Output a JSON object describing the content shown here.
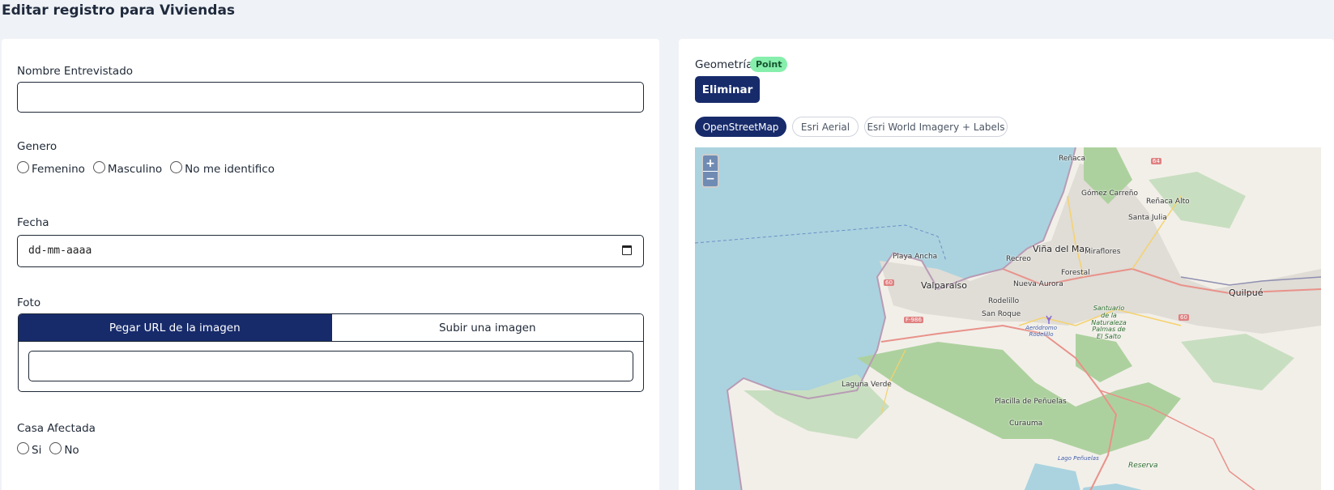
{
  "page": {
    "title": "Editar registro para Viviendas"
  },
  "form": {
    "nombre": {
      "label": "Nombre Entrevistado",
      "value": ""
    },
    "genero": {
      "label": "Genero",
      "options": [
        "Femenino",
        "Masculino",
        "No me identifico"
      ]
    },
    "fecha": {
      "label": "Fecha",
      "placeholder": "dd-mm-aaaa"
    },
    "foto": {
      "label": "Foto",
      "tabs": [
        "Pegar URL de la imagen",
        "Subir una imagen"
      ],
      "active_tab": "Pegar URL de la imagen",
      "url_value": ""
    },
    "casa": {
      "label": "Casa Afectada",
      "options": [
        "Si",
        "No"
      ]
    }
  },
  "geometry": {
    "label": "Geometría",
    "type_badge": "Point",
    "delete_label": "Eliminar",
    "layers": [
      "OpenStreetMap",
      "Esri Aerial",
      "Esri World Imagery + Labels"
    ],
    "active_layer": "OpenStreetMap"
  },
  "map": {
    "zoom_in": "+",
    "zoom_out": "−",
    "labels": {
      "renaca": "Reñaca",
      "gomez_carreno": "Gómez Carreño",
      "renaca_alto": "Reñaca Alto",
      "santa_julia": "Santa Julia",
      "playa_ancha": "Playa Ancha",
      "vina_del_mar": "Viña del Mar",
      "recreo": "Recreo",
      "miraflores": "Miraflores",
      "forestal": "Forestal",
      "valparaiso": "Valparaíso",
      "nueva_aurora": "Nueva Aurora",
      "rodelillo": "Rodelillo",
      "san_roque": "San Roque",
      "quilpue": "Quilpué",
      "laguna_verde": "Laguna Verde",
      "placilla": "Placilla de Peñuelas",
      "curauma": "Curauma",
      "reserva": "Reserva",
      "santuario": "Santuario de la Naturaleza Palmas de El Salto",
      "aerodromo": "Aeródromo Rodelillo",
      "lago": "Lago Peñuelas",
      "r64": "64",
      "r60a": "60",
      "r60b": "60",
      "rf986": "F-986"
    }
  }
}
